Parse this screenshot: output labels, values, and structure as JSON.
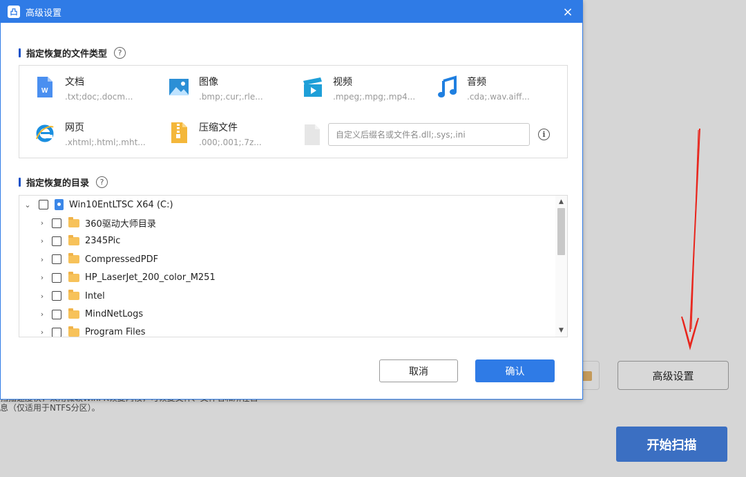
{
  "dialog": {
    "title": "高级设置",
    "close_symbol": "×",
    "file_types_section": {
      "title": "指定恢复的文件类型",
      "help_symbol": "?",
      "types": [
        {
          "name": "文档",
          "ext": ".txt;doc;.docm...",
          "icon": "document-icon"
        },
        {
          "name": "图像",
          "ext": ".bmp;.cur;.rle...",
          "icon": "image-icon"
        },
        {
          "name": "视频",
          "ext": ".mpeg;.mpg;.mp4...",
          "icon": "video-icon"
        },
        {
          "name": "音频",
          "ext": ".cda;.wav.aiff...",
          "icon": "music-icon"
        },
        {
          "name": "网页",
          "ext": ".xhtml;.html;.mht...",
          "icon": "ie-icon"
        },
        {
          "name": "压缩文件",
          "ext": ".000;.001;.7z...",
          "icon": "zip-icon"
        }
      ],
      "custom_placeholder": "自定义后缀名或文件名.dll;.sys;.ini",
      "info_symbol": "i"
    },
    "directory_section": {
      "title": "指定恢复的目录",
      "help_symbol": "?",
      "root": {
        "label": "Win10EntLTSC X64 (C:)",
        "expanded": true,
        "checked": false
      },
      "folders": [
        "360驱动大师目录",
        "2345Pic",
        "CompressedPDF",
        "HP_LaserJet_200_color_M251",
        "Intel",
        "MindNetLogs",
        "Program Files"
      ]
    },
    "buttons": {
      "cancel": "取消",
      "ok": "确认"
    }
  },
  "background": {
    "desc_line1": "扫描速度快，采用微软WinFR恢复内核，可恢复文件、文件名和所在目",
    "desc_line2": "息（仅适用于NTFS分区）。",
    "advanced_button": "高级设置",
    "start_button": "开始扫描",
    "arrow_color": "#e8251c"
  },
  "colors": {
    "accent": "#2f7be6",
    "section_bar": "#1a52c8"
  }
}
